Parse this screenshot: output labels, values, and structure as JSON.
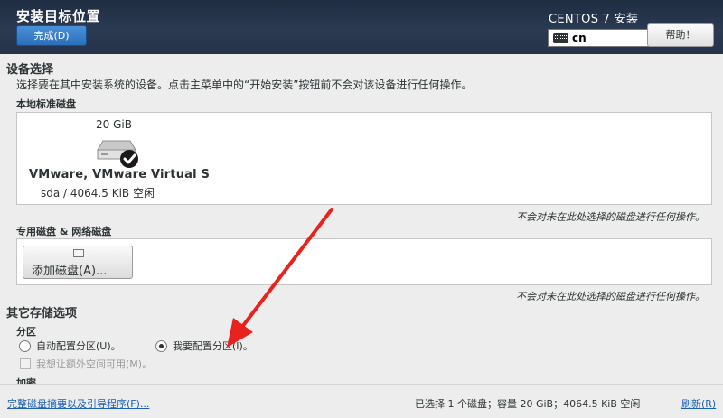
{
  "header": {
    "title": "安装目标位置",
    "done_label": "完成(D)",
    "product_title": "CENTOS 7 安装",
    "keyboard_layout": "cn",
    "help_label": "帮助！"
  },
  "device_selection": {
    "heading": "设备选择",
    "description": "选择要在其中安装系统的设备。点击主菜单中的“开始安装”按钮前不会对该设备进行任何操作。",
    "local_disks": {
      "heading": "本地标准磁盘",
      "disks": [
        {
          "size": "20 GiB",
          "name": "VMware, VMware Virtual S",
          "info": "sda   /   4064.5 KiB 空闲",
          "selected": true,
          "icon": "hard-disk-icon"
        }
      ],
      "note": "不会对未在此处选择的磁盘进行任何操作。"
    },
    "special_disks": {
      "heading": "专用磁盘 & 网络磁盘",
      "add_button_label": "添加磁盘(A)...",
      "note": "不会对未在此处选择的磁盘进行任何操作。"
    }
  },
  "other_storage": {
    "heading": "其它存储选项",
    "partitioning": {
      "heading": "分区",
      "auto_label": "自动配置分区(U)。",
      "manual_label": "我要配置分区(I)。",
      "selected": "manual",
      "extra_space_label": "我想让额外空间可用(M)。"
    },
    "encryption_heading": "加密"
  },
  "footer": {
    "summary_link": "完整磁盘摘要以及引导程序(F)...",
    "status": "已选择 1 个磁盘；容量 20 GiB；4064.5 KiB 空闲",
    "refresh_link": "刷新(R)"
  },
  "colors": {
    "header_bg": "#24334a",
    "accent_button": "#2b6fba",
    "annotation_arrow": "#e8231e",
    "link": "#1a5fb4"
  }
}
